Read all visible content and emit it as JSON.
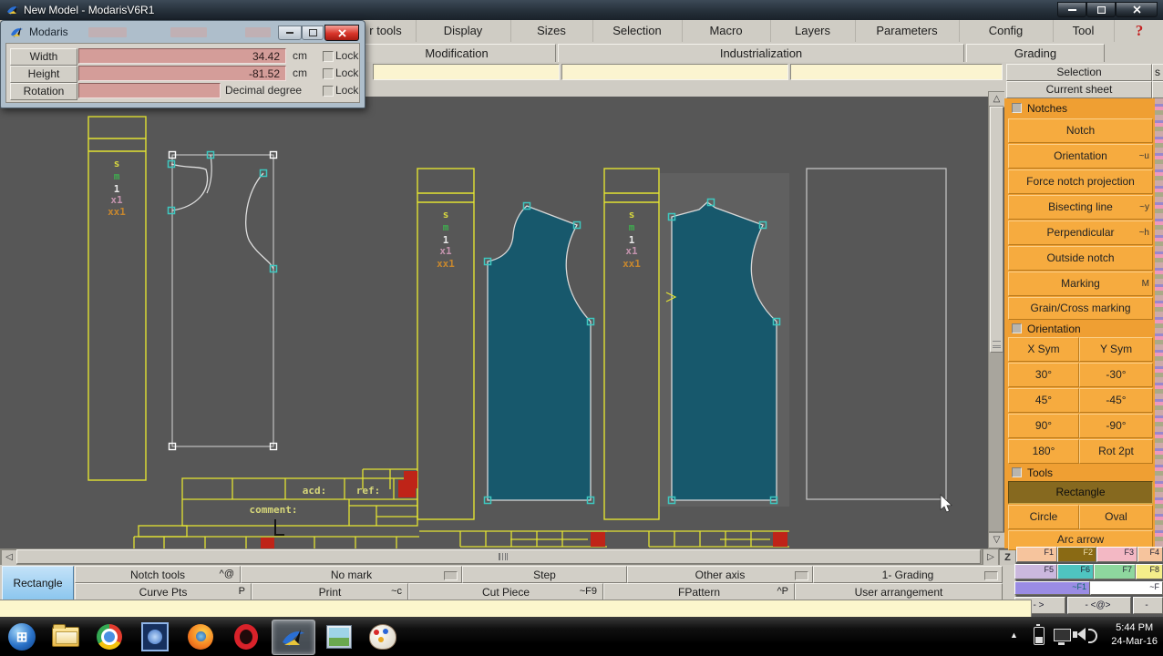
{
  "window": {
    "title": "New Model - ModarisV6R1"
  },
  "dialog": {
    "title": "Modaris",
    "rows": [
      {
        "label": "Width",
        "value": "34.42",
        "unit": "cm",
        "lock": "Lock"
      },
      {
        "label": "Height",
        "value": "-81.52",
        "unit": "cm",
        "lock": "Lock"
      },
      {
        "label": "Rotation",
        "value": "",
        "unit": "Decimal degree",
        "lock": "Lock"
      }
    ]
  },
  "menubar": {
    "items": [
      "r tools",
      "Display",
      "Sizes",
      "Selection",
      "Macro",
      "Layers",
      "Parameters",
      "Config",
      "Tool"
    ],
    "help": "?"
  },
  "menubar2": {
    "items": [
      "Modification",
      "Industrialization",
      "Grading"
    ]
  },
  "sidebar": {
    "selection": "Selection",
    "sliver": "s",
    "current_sheet": "Current sheet",
    "notches": {
      "header": "Notches",
      "buttons": [
        {
          "label": "Notch",
          "shortcut": ""
        },
        {
          "label": "Orientation",
          "shortcut": "~u"
        },
        {
          "label": "Force notch projection",
          "shortcut": ""
        },
        {
          "label": "Bisecting line",
          "shortcut": "~y"
        },
        {
          "label": "Perpendicular",
          "shortcut": "~h"
        },
        {
          "label": "Outside notch",
          "shortcut": ""
        },
        {
          "label": "Marking",
          "shortcut": "M"
        },
        {
          "label": "Grain/Cross marking",
          "shortcut": ""
        }
      ]
    },
    "orientation": {
      "header": "Orientation",
      "pairs": [
        [
          "X Sym",
          "Y Sym"
        ],
        [
          "30°",
          "-30°"
        ],
        [
          "45°",
          "-45°"
        ],
        [
          "90°",
          "-90°"
        ],
        [
          "180°",
          "Rot 2pt"
        ]
      ]
    },
    "tools": {
      "header": "Tools",
      "selected": "Rectangle",
      "pair": [
        "Circle",
        "Oval"
      ],
      "last": "Arc arrow"
    }
  },
  "bottombar": {
    "active_tool": "Rectangle",
    "row1": [
      {
        "label": "Notch tools",
        "shortcut": "^@"
      },
      {
        "label": "No mark",
        "shortcut": ""
      },
      {
        "label": "Step",
        "shortcut": ""
      },
      {
        "label": "Other axis",
        "shortcut": ""
      },
      {
        "label": "1- Grading",
        "shortcut": ""
      }
    ],
    "row2": [
      {
        "label": "Curve Pts",
        "shortcut": "P"
      },
      {
        "label": "Print",
        "shortcut": "~c"
      },
      {
        "label": "Cut Piece",
        "shortcut": "~F9"
      },
      {
        "label": "FPattern",
        "shortcut": "^P"
      },
      {
        "label": "User arrangement",
        "shortcut": ""
      }
    ]
  },
  "fnpad": {
    "row0": [
      "F1",
      "F2",
      "F3",
      "F4"
    ],
    "row1": [
      "F5",
      "F6",
      "F7",
      "F8"
    ],
    "row2": [
      "~F1",
      "~F"
    ],
    "row3": [
      "- >",
      "- <@>",
      "-"
    ]
  },
  "icons": {
    "up": "△",
    "down": "▽",
    "left": "◁",
    "right": "▷",
    "zoom": "Z"
  },
  "canvas": {
    "size_labels": [
      "s",
      "m",
      "1",
      "x1",
      "xx1"
    ],
    "title_block": {
      "acd": "acd:",
      "ref": "ref:",
      "comment": "comment:"
    }
  },
  "taskbar": {
    "time": "5:44 PM",
    "date": "24-Mar-16"
  },
  "colors": {
    "teal": "#17586c",
    "yellow": "#e2e232",
    "canvas": "#575757",
    "orange": "#f6ab3f"
  }
}
